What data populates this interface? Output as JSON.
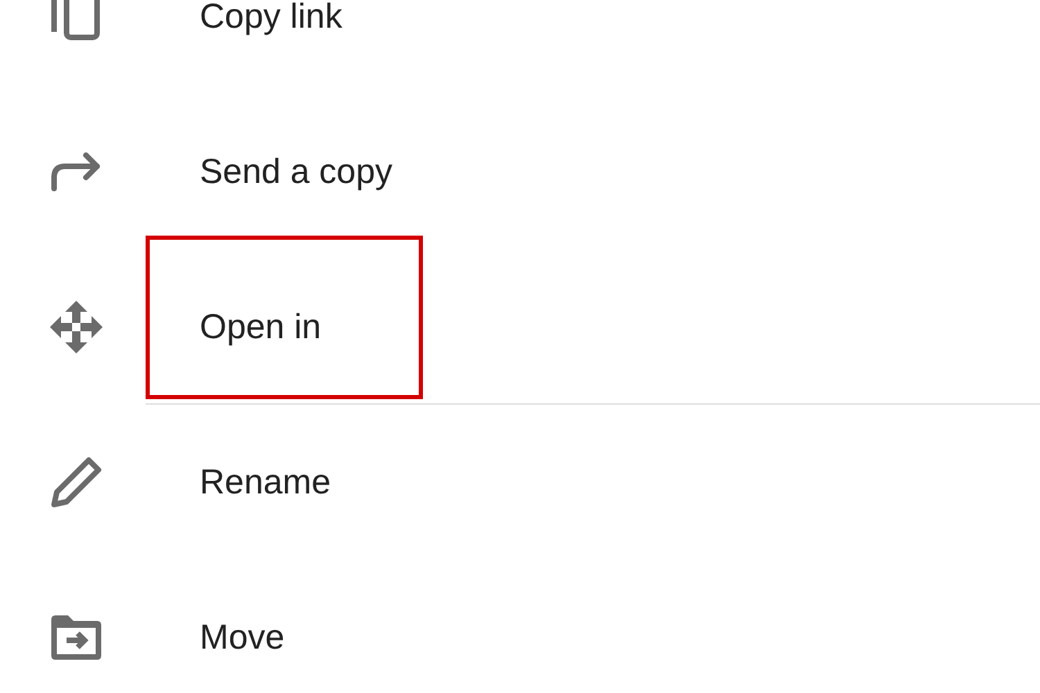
{
  "menu": {
    "items": [
      {
        "kind": "copy",
        "label": "Copy link",
        "highlighted": false,
        "divider_after": false
      },
      {
        "kind": "send",
        "label": "Send a copy",
        "highlighted": false,
        "divider_after": false
      },
      {
        "kind": "open",
        "label": "Open in",
        "highlighted": true,
        "divider_after": true
      },
      {
        "kind": "rename",
        "label": "Rename",
        "highlighted": false,
        "divider_after": false
      },
      {
        "kind": "move",
        "label": "Move",
        "highlighted": false,
        "divider_after": false
      }
    ]
  }
}
